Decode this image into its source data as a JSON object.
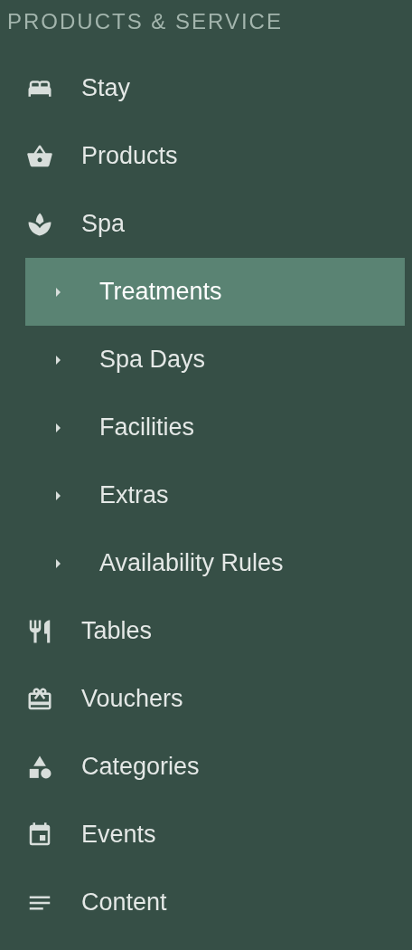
{
  "section_title": "PRODUCTS & SERVICE",
  "items": [
    {
      "label": "Stay"
    },
    {
      "label": "Products"
    },
    {
      "label": "Spa",
      "children": [
        {
          "label": "Treatments",
          "selected": true
        },
        {
          "label": "Spa Days",
          "selected": false
        },
        {
          "label": "Facilities",
          "selected": false
        },
        {
          "label": "Extras",
          "selected": false
        },
        {
          "label": "Availability Rules",
          "selected": false
        }
      ]
    },
    {
      "label": "Tables"
    },
    {
      "label": "Vouchers"
    },
    {
      "label": "Categories"
    },
    {
      "label": "Events"
    },
    {
      "label": "Content"
    }
  ]
}
